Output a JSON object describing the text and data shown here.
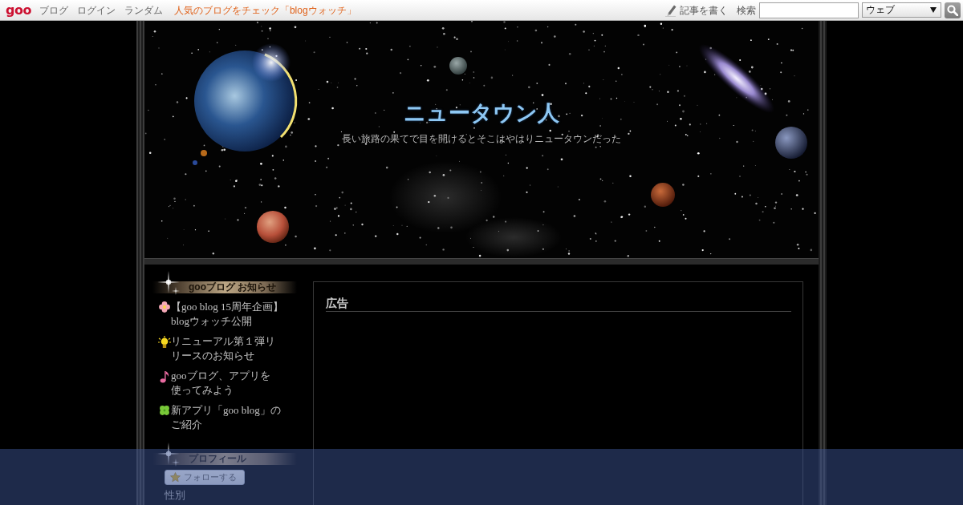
{
  "top_bar": {
    "logo": "goo",
    "nav_links": [
      "ブログ",
      "ログイン",
      "ランダム"
    ],
    "promo_link": "人気のブログをチェック「blogウォッチ」",
    "write_link": "記事を書く",
    "search_label": "検索",
    "search_scope": "ウェブ"
  },
  "header": {
    "title": "ニュータウン人",
    "subtitle": "長い旅路の果てで目を開けるとそこはやはりニュータウンだった"
  },
  "sidebar": {
    "news": {
      "heading": "gooブログ お知らせ",
      "items": [
        {
          "kind": "flower",
          "lines": [
            "【goo blog 15周年企画】",
            "blogウォッチ公開"
          ]
        },
        {
          "kind": "bulb",
          "lines": [
            "リニューアル第１弾リ",
            "リースのお知らせ"
          ]
        },
        {
          "kind": "note",
          "lines": [
            "gooブログ、アプリを",
            "使ってみよう"
          ]
        },
        {
          "kind": "clover",
          "lines": [
            "新アプリ「goo blog」の",
            "ご紹介"
          ]
        }
      ]
    },
    "profile": {
      "heading": "プロフィール",
      "follow_button": "フォローする",
      "fields": [
        "性別"
      ]
    }
  },
  "main": {
    "panel_heading": "広告"
  }
}
